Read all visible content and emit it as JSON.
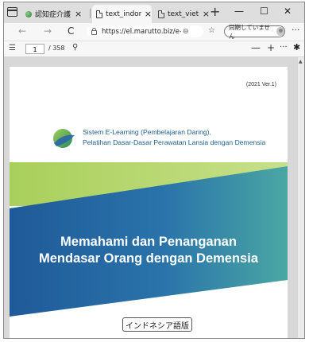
{
  "browser": {
    "tabs": [
      {
        "label": "認知症介護",
        "active": false
      },
      {
        "label": "text_indonesia",
        "active": true
      },
      {
        "label": "text_vietnam",
        "active": false
      }
    ],
    "close_glyph": "×",
    "new_tab_glyph": "+",
    "window_buttons": {
      "minimize": "—",
      "maximize": "☐",
      "close": "✕"
    },
    "nav": {
      "back": "←",
      "forward": "→",
      "refresh": "C"
    },
    "url": "https://el.marutto.biz/e-learning/text_indonesia.pdf",
    "sync_label": "同期していません",
    "more_glyph": "···"
  },
  "pdf_toolbar": {
    "current_page": "1",
    "total_pages": "/ 358",
    "zoom_out": "—",
    "zoom_in": "+",
    "more": "···"
  },
  "document": {
    "version": "(2021 Ver.1)",
    "subtitle_line1": "Sistem E-Learning (Pembelajaran Daring),",
    "subtitle_line2": "Pelatihan Dasar-Dasar Perawatan Lansia dengan Demensia",
    "title_line1": "Memahami dan Penanganan",
    "title_line2": "Mendasar Orang dengan Demensia",
    "language_badge": "インドネシア語版",
    "colors": {
      "blue": "#1f5fa0",
      "green": "#a9cf5b",
      "teal": "#48a7a0"
    }
  }
}
